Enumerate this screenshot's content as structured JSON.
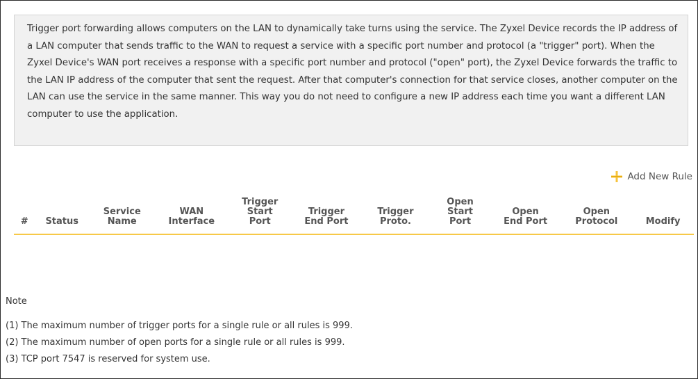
{
  "description": "Trigger port forwarding allows computers on the LAN to dynamically take turns using the service. The Zyxel Device records the IP address of a LAN computer that sends traffic to the WAN to request a service with a specific port number and protocol (a \"trigger\" port). When the Zyxel Device's WAN port receives a response with a specific port number and protocol (\"open\" port), the Zyxel Device forwards the traffic to the LAN IP address of the computer that sent the request. After that computer's connection for that service closes, another computer on the LAN can use the service in the same manner. This way you do not need to configure a new IP address each time you want a different LAN computer to use the application.",
  "add_rule": {
    "label": "Add New Rule",
    "icon": "plus-icon",
    "icon_color": "#f7c33c"
  },
  "table": {
    "header_underline_color": "#f7c948",
    "columns": [
      "#",
      "Status",
      "Service Name",
      "WAN Interface",
      "Trigger Start Port",
      "Trigger End Port",
      "Trigger Proto.",
      "Open Start Port",
      "Open End Port",
      "Open Protocol",
      "Modify"
    ],
    "rows": []
  },
  "note": {
    "title": "Note",
    "lines": [
      "(1) The maximum number of trigger ports for a single rule or all rules is 999.",
      "(2) The maximum number of open ports for a single rule or all rules is 999.",
      "(3) TCP port 7547 is reserved for system use."
    ]
  }
}
